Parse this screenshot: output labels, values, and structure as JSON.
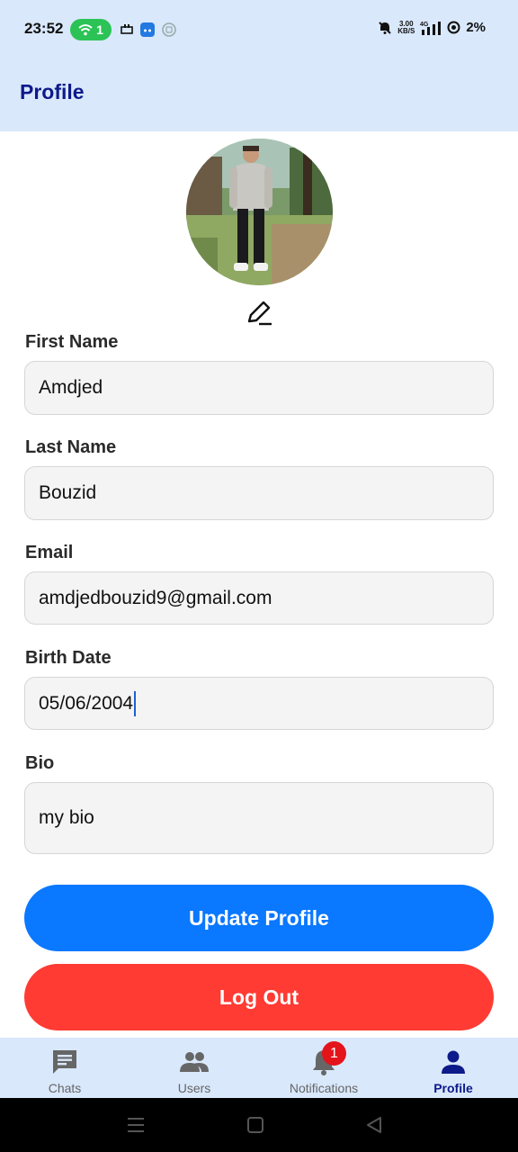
{
  "status_bar": {
    "time": "23:52",
    "wifi_count": "1",
    "speed_value": "3.00",
    "speed_unit": "KB/S",
    "network": "4G",
    "battery": "2%"
  },
  "header": {
    "title": "Profile"
  },
  "form": {
    "first_name": {
      "label": "First Name",
      "value": "Amdjed"
    },
    "last_name": {
      "label": "Last Name",
      "value": "Bouzid"
    },
    "email": {
      "label": "Email",
      "value": "amdjedbouzid9@gmail.com"
    },
    "birth_date": {
      "label": "Birth Date",
      "value": "05/06/2004"
    },
    "bio": {
      "label": "Bio",
      "value": "my bio"
    }
  },
  "buttons": {
    "update": "Update Profile",
    "logout": "Log Out"
  },
  "bottom_nav": {
    "items": [
      {
        "label": "Chats",
        "icon": "chat-icon"
      },
      {
        "label": "Users",
        "icon": "users-icon"
      },
      {
        "label": "Notifications",
        "icon": "bell-icon",
        "badge": "1"
      },
      {
        "label": "Profile",
        "icon": "person-icon",
        "active": true
      }
    ]
  },
  "colors": {
    "header_bg": "#d9e8fb",
    "title": "#0d1a8a",
    "update_button": "#0a78ff",
    "logout_button": "#ff3b33",
    "badge": "#e4141b"
  }
}
